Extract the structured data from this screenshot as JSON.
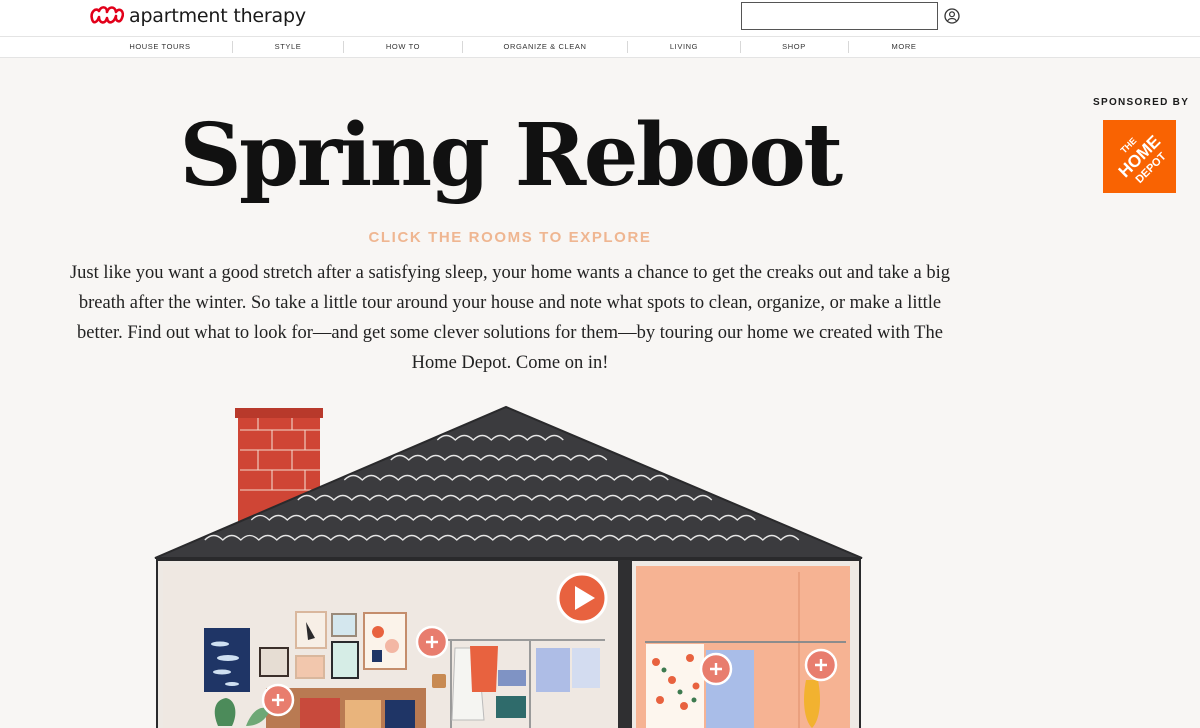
{
  "header": {
    "brand": "apartment therapy",
    "search": {
      "value": "",
      "placeholder": ""
    },
    "icons": [
      "logo-mark",
      "search-icon",
      "user-icon"
    ]
  },
  "nav": {
    "items": [
      "HOUSE TOURS",
      "STYLE",
      "HOW TO",
      "ORGANIZE & CLEAN",
      "LIVING",
      "SHOP",
      "MORE"
    ]
  },
  "sponsor": {
    "label": "SPONSORED BY",
    "logo_text": "THE HOME DEPOT"
  },
  "hero": {
    "title": "Spring Reboot",
    "cta": "CLICK THE ROOMS TO EXPLORE",
    "intro": "Just like you want a good stretch after a satisfying sleep, your home wants a chance to get the creaks out and take a big breath after the winter. So take a little tour around your house and note what spots to clean, organize, or make a little better. Find out what to look for—and get some clever solutions for them—by touring our home we created with The Home Depot. Come on in!"
  },
  "illustration": {
    "hotspot_glyph": "+",
    "play_glyph": "play-icon",
    "colors": {
      "roof": "#3b3b3e",
      "chimney": "#cf4535",
      "accent": "#e87d6e",
      "play": "#e8623f",
      "peach_room": "#f6b393",
      "brand_red": "#e2001a",
      "home_depot_orange": "#f96302"
    }
  }
}
